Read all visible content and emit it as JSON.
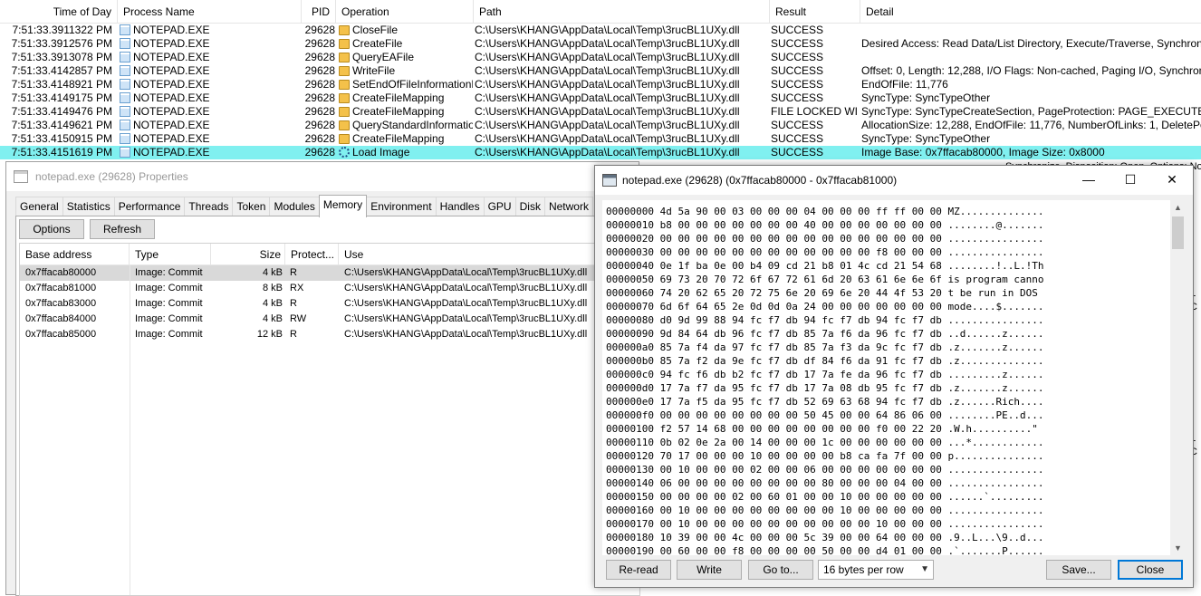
{
  "procmon": {
    "columns": [
      "Time of Day",
      "Process Name",
      "PID",
      "Operation",
      "Path",
      "Result",
      "Detail"
    ],
    "rows": [
      {
        "time": "7:51:33.3911322 PM",
        "process": "NOTEPAD.EXE",
        "pid": "29628",
        "operation": "CloseFile",
        "path": "C:\\Users\\KHANG\\AppData\\Local\\Temp\\3rucBL1UXy.dll",
        "result": "SUCCESS",
        "detail": ""
      },
      {
        "time": "7:51:33.3912576 PM",
        "process": "NOTEPAD.EXE",
        "pid": "29628",
        "operation": "CreateFile",
        "path": "C:\\Users\\KHANG\\AppData\\Local\\Temp\\3rucBL1UXy.dll",
        "result": "SUCCESS",
        "detail": "Desired Access: Read Data/List Directory, Execute/Traverse, Synchronize, Dis"
      },
      {
        "time": "7:51:33.3913078 PM",
        "process": "NOTEPAD.EXE",
        "pid": "29628",
        "operation": "QueryEAFile",
        "path": "C:\\Users\\KHANG\\AppData\\Local\\Temp\\3rucBL1UXy.dll",
        "result": "SUCCESS",
        "detail": ""
      },
      {
        "time": "7:51:33.4142857 PM",
        "process": "NOTEPAD.EXE",
        "pid": "29628",
        "operation": "WriteFile",
        "path": "C:\\Users\\KHANG\\AppData\\Local\\Temp\\3rucBL1UXy.dll",
        "result": "SUCCESS",
        "detail": "Offset: 0, Length: 12,288, I/O Flags: Non-cached, Paging I/O, Synchronous Pa"
      },
      {
        "time": "7:51:33.4148921 PM",
        "process": "NOTEPAD.EXE",
        "pid": "29628",
        "operation": "SetEndOfFileInformationFile",
        "path": "C:\\Users\\KHANG\\AppData\\Local\\Temp\\3rucBL1UXy.dll",
        "result": "SUCCESS",
        "detail": "EndOfFile: 11,776"
      },
      {
        "time": "7:51:33.4149175 PM",
        "process": "NOTEPAD.EXE",
        "pid": "29628",
        "operation": "CreateFileMapping",
        "path": "C:\\Users\\KHANG\\AppData\\Local\\Temp\\3rucBL1UXy.dll",
        "result": "SUCCESS",
        "detail": "SyncType: SyncTypeOther"
      },
      {
        "time": "7:51:33.4149476 PM",
        "process": "NOTEPAD.EXE",
        "pid": "29628",
        "operation": "CreateFileMapping",
        "path": "C:\\Users\\KHANG\\AppData\\Local\\Temp\\3rucBL1UXy.dll",
        "result": "FILE LOCKED WI...",
        "detail": "SyncType: SyncTypeCreateSection, PageProtection: PAGE_EXECUTE_READ"
      },
      {
        "time": "7:51:33.4149621 PM",
        "process": "NOTEPAD.EXE",
        "pid": "29628",
        "operation": "QueryStandardInformation...",
        "path": "C:\\Users\\KHANG\\AppData\\Local\\Temp\\3rucBL1UXy.dll",
        "result": "SUCCESS",
        "detail": "AllocationSize: 12,288, EndOfFile: 11,776, NumberOfLinks: 1, DeletePending: F"
      },
      {
        "time": "7:51:33.4150915 PM",
        "process": "NOTEPAD.EXE",
        "pid": "29628",
        "operation": "CreateFileMapping",
        "path": "C:\\Users\\KHANG\\AppData\\Local\\Temp\\3rucBL1UXy.dll",
        "result": "SUCCESS",
        "detail": "SyncType: SyncTypeOther"
      },
      {
        "time": "7:51:33.4151619 PM",
        "process": "NOTEPAD.EXE",
        "pid": "29628",
        "operation": "Load Image",
        "path": "C:\\Users\\KHANG\\AppData\\Local\\Temp\\3rucBL1UXy.dll",
        "result": "SUCCESS",
        "detail": "Image Base: 0x7ffacab80000, Image Size: 0x8000"
      }
    ]
  },
  "properties": {
    "title": "notepad.exe (29628) Properties",
    "tabs": [
      "General",
      "Statistics",
      "Performance",
      "Threads",
      "Token",
      "Modules",
      "Memory",
      "Environment",
      "Handles",
      "GPU",
      "Disk",
      "Network"
    ],
    "active_tab": "Memory",
    "options_label": "Options",
    "refresh_label": "Refresh",
    "columns": [
      "Base address",
      "Type",
      "Size",
      "Protect...",
      "Use"
    ],
    "rows": [
      {
        "base": "0x7ffacab80000",
        "type": "Image: Commit",
        "size": "4 kB",
        "protect": "R",
        "use": "C:\\Users\\KHANG\\AppData\\Local\\Temp\\3rucBL1UXy.dll"
      },
      {
        "base": "0x7ffacab81000",
        "type": "Image: Commit",
        "size": "8 kB",
        "protect": "RX",
        "use": "C:\\Users\\KHANG\\AppData\\Local\\Temp\\3rucBL1UXy.dll"
      },
      {
        "base": "0x7ffacab83000",
        "type": "Image: Commit",
        "size": "4 kB",
        "protect": "R",
        "use": "C:\\Users\\KHANG\\AppData\\Local\\Temp\\3rucBL1UXy.dll"
      },
      {
        "base": "0x7ffacab84000",
        "type": "Image: Commit",
        "size": "4 kB",
        "protect": "RW",
        "use": "C:\\Users\\KHANG\\AppData\\Local\\Temp\\3rucBL1UXy.dll"
      },
      {
        "base": "0x7ffacab85000",
        "type": "Image: Commit",
        "size": "12 kB",
        "protect": "R",
        "use": "C:\\Users\\KHANG\\AppData\\Local\\Temp\\3rucBL1UXy.dll"
      }
    ]
  },
  "hexview": {
    "title": "notepad.exe (29628) (0x7ffacab80000 - 0x7ffacab81000)",
    "minimize": "—",
    "maximize": "☐",
    "close": "✕",
    "lines": [
      "00000000 4d 5a 90 00 03 00 00 00 04 00 00 00 ff ff 00 00 MZ..............",
      "00000010 b8 00 00 00 00 00 00 00 40 00 00 00 00 00 00 00 ........@.......",
      "00000020 00 00 00 00 00 00 00 00 00 00 00 00 00 00 00 00 ................",
      "00000030 00 00 00 00 00 00 00 00 00 00 00 00 f8 00 00 00 ................",
      "00000040 0e 1f ba 0e 00 b4 09 cd 21 b8 01 4c cd 21 54 68 ........!..L.!Th",
      "00000050 69 73 20 70 72 6f 67 72 61 6d 20 63 61 6e 6e 6f is program canno",
      "00000060 74 20 62 65 20 72 75 6e 20 69 6e 20 44 4f 53 20 t be run in DOS ",
      "00000070 6d 6f 64 65 2e 0d 0d 0a 24 00 00 00 00 00 00 00 mode....$.......",
      "00000080 d0 9d 99 88 94 fc f7 db 94 fc f7 db 94 fc f7 db ................",
      "00000090 9d 84 64 db 96 fc f7 db 85 7a f6 da 96 fc f7 db ..d......z......",
      "000000a0 85 7a f4 da 97 fc f7 db 85 7a f3 da 9c fc f7 db .z.......z......",
      "000000b0 85 7a f2 da 9e fc f7 db df 84 f6 da 91 fc f7 db .z..............",
      "000000c0 94 fc f6 db b2 fc f7 db 17 7a fe da 96 fc f7 db .........z......",
      "000000d0 17 7a f7 da 95 fc f7 db 17 7a 08 db 95 fc f7 db .z.......z......",
      "000000e0 17 7a f5 da 95 fc f7 db 52 69 63 68 94 fc f7 db .z......Rich....",
      "000000f0 00 00 00 00 00 00 00 00 50 45 00 00 64 86 06 00 ........PE..d...",
      "00000100 f2 57 14 68 00 00 00 00 00 00 00 00 f0 00 22 20 .W.h..........\" ",
      "00000110 0b 02 0e 2a 00 14 00 00 00 1c 00 00 00 00 00 00 ...*............",
      "00000120 70 17 00 00 00 10 00 00 00 00 b8 ca fa 7f 00 00 p...............",
      "00000130 00 10 00 00 00 02 00 00 06 00 00 00 00 00 00 00 ................",
      "00000140 06 00 00 00 00 00 00 00 00 80 00 00 00 04 00 00 ................",
      "00000150 00 00 00 00 02 00 60 01 00 00 10 00 00 00 00 00 ......`.........",
      "00000160 00 10 00 00 00 00 00 00 00 00 10 00 00 00 00 00 ................",
      "00000170 00 10 00 00 00 00 00 00 00 00 00 00 10 00 00 00 ................",
      "00000180 10 39 00 00 4c 00 00 00 5c 39 00 00 64 00 00 00 .9..L...\\9..d...",
      "00000190 00 60 00 00 f8 00 00 00 00 50 00 00 d4 01 00 00 .`.......P......"
    ],
    "buttons": {
      "reread": "Re-read",
      "write": "Write",
      "goto": "Go to...",
      "save": "Save...",
      "close": "Close"
    },
    "bytes_per_row": "16 bytes per row"
  },
  "background": {
    "fragments": [
      "Synchronize, Disposition: Open, Options: Nor",
      "L",
      "C",
      "L",
      "C"
    ]
  }
}
